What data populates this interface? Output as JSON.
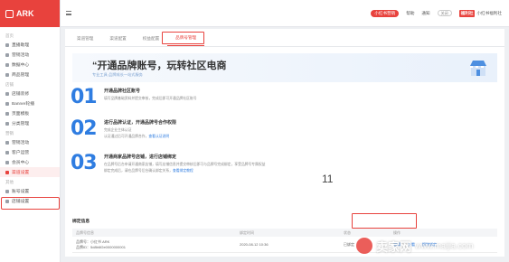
{
  "brand": {
    "name": "ARK"
  },
  "sidebar": {
    "items": [
      {
        "label": "首页",
        "type": "group"
      },
      {
        "label": "直播助理",
        "type": "item"
      },
      {
        "label": "营销活动",
        "type": "item"
      },
      {
        "label": "数据中心",
        "type": "item"
      },
      {
        "label": "商品管理",
        "type": "item"
      },
      {
        "label": "店铺",
        "type": "group"
      },
      {
        "label": "店铺装修",
        "type": "item"
      },
      {
        "label": "Banner轮播",
        "type": "item"
      },
      {
        "label": "页面模板",
        "type": "item"
      },
      {
        "label": "分类管理",
        "type": "item"
      },
      {
        "label": "营销",
        "type": "group"
      },
      {
        "label": "营销活动",
        "type": "item"
      },
      {
        "label": "客户运营",
        "type": "item"
      },
      {
        "label": "会员中心",
        "type": "item"
      },
      {
        "label": "渠道设置",
        "type": "item",
        "active": true
      },
      {
        "label": "其他",
        "type": "group"
      },
      {
        "label": "账号设置",
        "type": "item"
      },
      {
        "label": "店铺设置",
        "type": "item"
      }
    ]
  },
  "topbar": {
    "pill_label": "小红书营销",
    "help_label": "帮助",
    "notice_label": "通知",
    "toggle_label": "关闭",
    "shop_logo": "福利社",
    "shop_name": "小红书福利社"
  },
  "tabs": [
    {
      "label": "渠道管理",
      "active": false
    },
    {
      "label": "渠道配置",
      "active": false
    },
    {
      "label": "权益配置",
      "active": false
    },
    {
      "label": "品牌号管理",
      "active": true
    }
  ],
  "banner": {
    "title": "“开通品牌账号，玩转社区电商",
    "subtitle": "专业工具·品牌成长一站式服务"
  },
  "steps": [
    {
      "num": "01",
      "head": "开通品牌社区账号",
      "lines": [
        {
          "text": "填写品牌基础资料并提交审核，完成后即可开通品牌社区账号"
        }
      ]
    },
    {
      "num": "02",
      "head": "进行品牌认证，开通品牌号合作权限",
      "lines": [
        {
          "text": "完成企业主体认证",
          "link": ""
        },
        {
          "text": "认证通过后可开通品牌合作，",
          "link": "查看认证说明"
        }
      ]
    },
    {
      "num": "03",
      "head": "开通商家品牌号店铺，进行店铺绑定",
      "lines": [
        {
          "text": "在品牌号后台申请开通商家店铺，填写店铺信息并提交审核后即可与品牌号完成绑定，享受品牌号专属权益",
          "link": ""
        },
        {
          "text": "绑定完成后，请在品牌号后台确认绑定关系，",
          "link": "查看绑定教程"
        }
      ]
    }
  ],
  "overlay_number": "11",
  "table": {
    "title": "绑定信息",
    "headers": [
      "品牌号信息",
      "绑定时间",
      "状态",
      "操作"
    ],
    "rows": [
      {
        "info_line1": "品牌号：小红书 ARK",
        "info_line2": "品牌ID：5d8b6f2e0000000001",
        "time": "2020-08-12 10:36",
        "status": "已绑定",
        "ops": [
          "编辑",
          "查看",
          "解除绑定"
        ]
      }
    ]
  },
  "watermark": {
    "text": "卖家网",
    "url": "www.maijia.com"
  }
}
